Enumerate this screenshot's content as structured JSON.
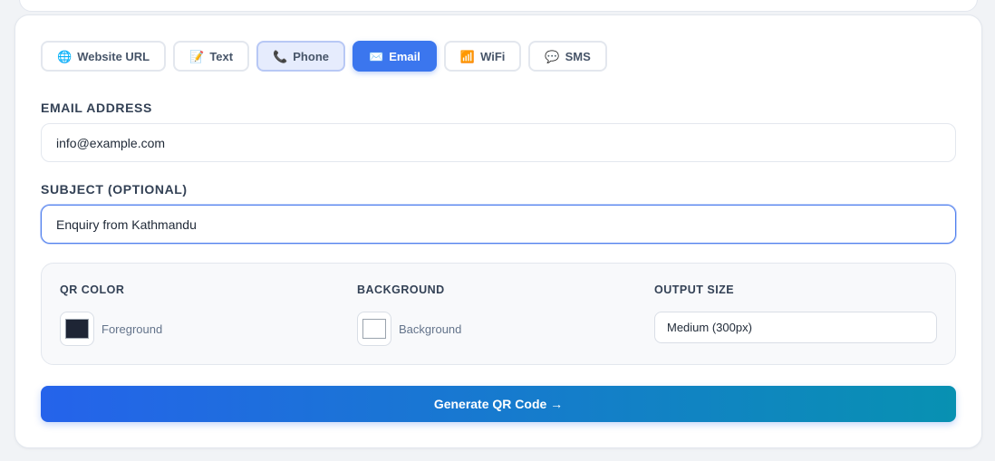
{
  "tabs": [
    {
      "icon": "🌐",
      "icon_name": "globe-icon",
      "label": "Website URL",
      "state": "normal"
    },
    {
      "icon": "📝",
      "icon_name": "memo-icon",
      "label": "Text",
      "state": "normal"
    },
    {
      "icon": "📞",
      "icon_name": "phone-icon",
      "label": "Phone",
      "state": "hover"
    },
    {
      "icon": "✉️",
      "icon_name": "envelope-icon",
      "label": "Email",
      "state": "active"
    },
    {
      "icon": "📶",
      "icon_name": "signal-icon",
      "label": "WiFi",
      "state": "normal"
    },
    {
      "icon": "💬",
      "icon_name": "speech-bubble-icon",
      "label": "SMS",
      "state": "normal"
    }
  ],
  "email": {
    "label": "EMAIL ADDRESS",
    "value": "info@example.com"
  },
  "subject": {
    "label": "SUBJECT (OPTIONAL)",
    "value": "Enquiry from Kathmandu"
  },
  "options": {
    "qr_color": {
      "label": "QR COLOR",
      "text": "Foreground",
      "color": "#1e2535"
    },
    "background": {
      "label": "BACKGROUND",
      "text": "Background",
      "color": "#ffffff"
    },
    "output_size": {
      "label": "OUTPUT SIZE",
      "selected": "Medium (300px)"
    }
  },
  "generate": {
    "label": "Generate QR Code →"
  },
  "colors": {
    "accent": "#3b76ee",
    "gradient_start": "#2563eb",
    "gradient_end": "#0891b2"
  }
}
